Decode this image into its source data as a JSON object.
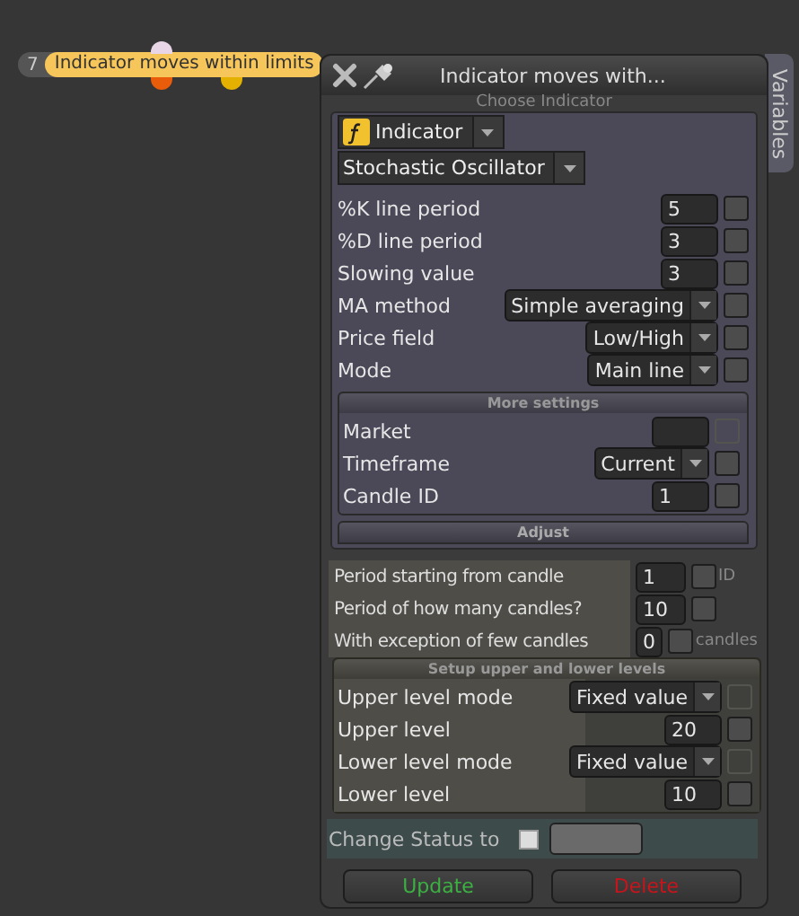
{
  "node": {
    "number": "7",
    "label": "Indicator moves within limits"
  },
  "panel": {
    "title": "Indicator moves with...",
    "side_tab": "Variables",
    "choose_label": "Choose Indicator",
    "indicator_button": "Indicator",
    "indicator_select": "Stochastic Oscillator",
    "params": [
      {
        "kind": "input",
        "label": "%K line period",
        "value": "5",
        "checked": false,
        "disabled": false
      },
      {
        "kind": "input",
        "label": "%D line period",
        "value": "3",
        "checked": false,
        "disabled": false
      },
      {
        "kind": "input",
        "label": "Slowing value",
        "value": "3",
        "checked": false,
        "disabled": false
      },
      {
        "kind": "select",
        "label": "MA method",
        "value": "Simple averaging",
        "checked": false,
        "disabled": false
      },
      {
        "kind": "select",
        "label": "Price field",
        "value": "Low/High",
        "checked": false,
        "disabled": false
      },
      {
        "kind": "select",
        "label": "Mode",
        "value": "Main line",
        "checked": false,
        "disabled": false
      }
    ],
    "more_settings": "More settings",
    "more_params": [
      {
        "kind": "input",
        "label": "Market",
        "checked": false,
        "disabled": true
      },
      {
        "kind": "select",
        "label": "Timeframe",
        "value": "Current",
        "checked": false,
        "disabled": false
      },
      {
        "kind": "input",
        "label": "Candle ID",
        "value": "1",
        "checked": false,
        "disabled": false
      }
    ],
    "adjust": "Adjust",
    "period_rows": [
      {
        "label": "Period starting from candle",
        "value": "1",
        "checked": false,
        "suffix": "ID"
      },
      {
        "label": "Period of how many candles?",
        "value": "10",
        "checked": false
      },
      {
        "label": "With exception of few candles",
        "value": "0",
        "checked": false,
        "suffix": "candles"
      }
    ],
    "levels_title": "Setup upper and lower levels",
    "levels": [
      {
        "kind": "select",
        "label": "Upper level mode",
        "value": "Fixed value",
        "checked": false,
        "disabled": true
      },
      {
        "kind": "input",
        "label": "Upper level",
        "value": "20",
        "checked": false,
        "disabled": false
      },
      {
        "kind": "select",
        "label": "Lower level mode",
        "value": "Fixed value",
        "checked": false,
        "disabled": true
      },
      {
        "kind": "input",
        "label": "Lower level",
        "value": "10",
        "checked": false,
        "disabled": false
      }
    ],
    "change_status": {
      "label": "Change Status to",
      "checked": false
    },
    "buttons": [
      {
        "kind": "update",
        "label": "Update"
      },
      {
        "kind": "delete",
        "label": "Delete"
      }
    ]
  }
}
